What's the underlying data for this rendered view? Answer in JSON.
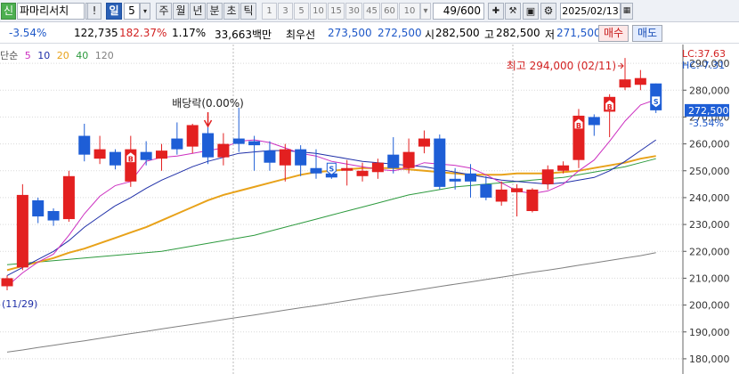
{
  "toolbar": {
    "badge": "신",
    "stock_name": "파마리서치",
    "exclamation": "!",
    "period": "일",
    "period_value": "5",
    "tabs": [
      "주",
      "월",
      "년",
      "분",
      "초",
      "틱"
    ],
    "minute_options": [
      "1",
      "3",
      "5",
      "10",
      "15",
      "30",
      "45",
      "60"
    ],
    "count_select": "10",
    "page_counter": "49/600",
    "date": "2025/02/13"
  },
  "info": {
    "change_pct": "-3.54%",
    "volume": "122,735",
    "volume_ratio": "182.37%",
    "turnover_pct": "1.17%",
    "trade_value": "33,663백만",
    "best_label": "최우선",
    "best_ask": "273,500",
    "best_bid": "272,500",
    "open_label": "시",
    "open": "282,500",
    "high_label": "고",
    "high": "282,500",
    "low_label": "저",
    "low": "271,500",
    "buy_label": "매수",
    "sell_label": "매도"
  },
  "legend": {
    "label": "단순",
    "periods": [
      "5",
      "10",
      "20",
      "40",
      "120"
    ],
    "colors": [
      "#cc2fc0",
      "#1f2fa8",
      "#e8a21a",
      "#2d9a3e",
      "#808080"
    ]
  },
  "chart_data": {
    "type": "candlestick",
    "y_ticks": [
      "290,000",
      "280,000",
      "270,000",
      "260,000",
      "250,000",
      "240,000",
      "230,000",
      "220,000",
      "210,000",
      "200,000",
      "190,000",
      "180,000"
    ],
    "ylim": [
      175000,
      296000
    ],
    "current_price": "272,500",
    "current_change": "-3.54%",
    "lc_label": "LC:37.63",
    "hc_label": "HC:-7.31",
    "high_annotation": "최고 294,000 (02/11)",
    "dividend_annotation": "배당락(0.00%)",
    "low_date_annotation": "(11/29)",
    "candles": [
      {
        "o": 207000,
        "h": 211000,
        "l": 205500,
        "c": 210000
      },
      {
        "o": 214000,
        "h": 245000,
        "l": 213000,
        "c": 241000
      },
      {
        "o": 239000,
        "h": 240000,
        "l": 230500,
        "c": 233000
      },
      {
        "o": 235000,
        "h": 236000,
        "l": 229500,
        "c": 231500
      },
      {
        "o": 232000,
        "h": 250000,
        "l": 231000,
        "c": 248000
      },
      {
        "o": 263000,
        "h": 267500,
        "l": 253500,
        "c": 256000
      },
      {
        "o": 254500,
        "h": 263000,
        "l": 252500,
        "c": 258000
      },
      {
        "o": 257000,
        "h": 258000,
        "l": 250500,
        "c": 252000
      },
      {
        "o": 246000,
        "h": 263000,
        "l": 244000,
        "c": 258000
      },
      {
        "o": 257000,
        "h": 261000,
        "l": 252000,
        "c": 254000
      },
      {
        "o": 254500,
        "h": 260000,
        "l": 250000,
        "c": 257500
      },
      {
        "o": 262000,
        "h": 268000,
        "l": 256000,
        "c": 258000
      },
      {
        "o": 259000,
        "h": 267500,
        "l": 256500,
        "c": 267000
      },
      {
        "o": 264000,
        "h": 268500,
        "l": 252500,
        "c": 255000
      },
      {
        "o": 255000,
        "h": 264000,
        "l": 252000,
        "c": 260000
      },
      {
        "o": 262000,
        "h": 273500,
        "l": 257000,
        "c": 260000
      },
      {
        "o": 261000,
        "h": 263000,
        "l": 250000,
        "c": 259500
      },
      {
        "o": 257500,
        "h": 261000,
        "l": 250000,
        "c": 253000
      },
      {
        "o": 252000,
        "h": 260000,
        "l": 246000,
        "c": 258000
      },
      {
        "o": 258000,
        "h": 259500,
        "l": 248000,
        "c": 252000
      },
      {
        "o": 251000,
        "h": 258000,
        "l": 247000,
        "c": 249000
      },
      {
        "o": 249000,
        "h": 250000,
        "l": 247000,
        "c": 247500
      },
      {
        "o": 250000,
        "h": 254000,
        "l": 244500,
        "c": 251000
      },
      {
        "o": 248000,
        "h": 253000,
        "l": 246000,
        "c": 250000
      },
      {
        "o": 249500,
        "h": 254500,
        "l": 247000,
        "c": 253000
      },
      {
        "o": 256000,
        "h": 262500,
        "l": 249000,
        "c": 251000
      },
      {
        "o": 251000,
        "h": 262000,
        "l": 249000,
        "c": 257000
      },
      {
        "o": 259000,
        "h": 265000,
        "l": 256500,
        "c": 262000
      },
      {
        "o": 262000,
        "h": 263500,
        "l": 243000,
        "c": 244000
      },
      {
        "o": 247000,
        "h": 251000,
        "l": 243000,
        "c": 246000
      },
      {
        "o": 249000,
        "h": 252500,
        "l": 240000,
        "c": 246000
      },
      {
        "o": 245000,
        "h": 248000,
        "l": 239000,
        "c": 240000
      },
      {
        "o": 238500,
        "h": 246000,
        "l": 237000,
        "c": 243000
      },
      {
        "o": 242000,
        "h": 245000,
        "l": 233000,
        "c": 243500
      },
      {
        "o": 235000,
        "h": 243500,
        "l": 234500,
        "c": 243000
      },
      {
        "o": 245000,
        "h": 252000,
        "l": 243000,
        "c": 250500
      },
      {
        "o": 250000,
        "h": 253500,
        "l": 249000,
        "c": 252000
      },
      {
        "o": 254000,
        "h": 273000,
        "l": 251000,
        "c": 270500
      },
      {
        "o": 270000,
        "h": 271000,
        "l": 263000,
        "c": 267000
      },
      {
        "o": 272000,
        "h": 278500,
        "l": 262500,
        "c": 277500
      },
      {
        "o": 281000,
        "h": 292000,
        "l": 280000,
        "c": 284000
      },
      {
        "o": 282000,
        "h": 287500,
        "l": 280000,
        "c": 284500
      },
      {
        "o": 282500,
        "h": 282500,
        "l": 271500,
        "c": 272500
      }
    ],
    "ma": {
      "5": [
        207000,
        212000,
        216000,
        219000,
        226000,
        234000,
        240500,
        244500,
        246000,
        253500,
        255000,
        255500,
        256500,
        257500,
        258500,
        261000,
        261500,
        260500,
        258500,
        256500,
        255500,
        253500,
        252500,
        251500,
        250500,
        250000,
        251000,
        253000,
        252500,
        252000,
        251000,
        248500,
        245500,
        242500,
        241500,
        242500,
        245000,
        250000,
        254000,
        261000,
        268500,
        274500,
        276500
      ],
      "10": [
        211000,
        214000,
        217000,
        220000,
        224000,
        229000,
        233000,
        237000,
        240000,
        243500,
        246500,
        249000,
        251500,
        253500,
        255000,
        256500,
        257000,
        257500,
        257500,
        257000,
        256500,
        255500,
        254500,
        253500,
        253000,
        252500,
        252000,
        251500,
        250500,
        249500,
        248500,
        247500,
        246500,
        246000,
        245500,
        245000,
        245500,
        246500,
        247500,
        250000,
        253500,
        257500,
        261500
      ],
      "20": [
        213000,
        214500,
        216000,
        217500,
        219500,
        221000,
        223000,
        225000,
        227000,
        229000,
        231500,
        234000,
        236500,
        239000,
        241000,
        242500,
        244000,
        245500,
        247000,
        248500,
        249500,
        250000,
        250500,
        251000,
        251000,
        251000,
        250500,
        250000,
        249500,
        249000,
        248500,
        248500,
        248500,
        249000,
        249000,
        249000,
        249500,
        250000,
        251000,
        252000,
        253000,
        254500,
        255500
      ],
      "40": [
        215000,
        215500,
        216000,
        216500,
        217000,
        217500,
        218000,
        218500,
        219000,
        219500,
        220000,
        221000,
        222000,
        223000,
        224000,
        225000,
        226000,
        227500,
        229000,
        230500,
        232000,
        233500,
        235000,
        236500,
        238000,
        239500,
        241000,
        242000,
        243000,
        244000,
        244500,
        245000,
        245500,
        246000,
        246500,
        247000,
        247500,
        248500,
        249500,
        250500,
        251500,
        253000,
        254500
      ],
      "120": [
        182500,
        183300,
        184200,
        185000,
        185900,
        186700,
        187600,
        188500,
        189400,
        190200,
        191100,
        192000,
        192800,
        193700,
        194600,
        195500,
        196300,
        197200,
        198100,
        199000,
        199800,
        200700,
        201600,
        202500,
        203400,
        204200,
        205100,
        206000,
        206900,
        207800,
        208600,
        209500,
        210400,
        211300,
        212200,
        213000,
        213900,
        214800,
        215700,
        216600,
        217500,
        218400,
        219500
      ]
    },
    "buy_signals": [
      8,
      37,
      39
    ],
    "sell_signals": [
      21,
      42
    ],
    "colors": {
      "up": "#e32020",
      "down": "#1e5ed6",
      "grid": "#d9d9d9"
    }
  }
}
